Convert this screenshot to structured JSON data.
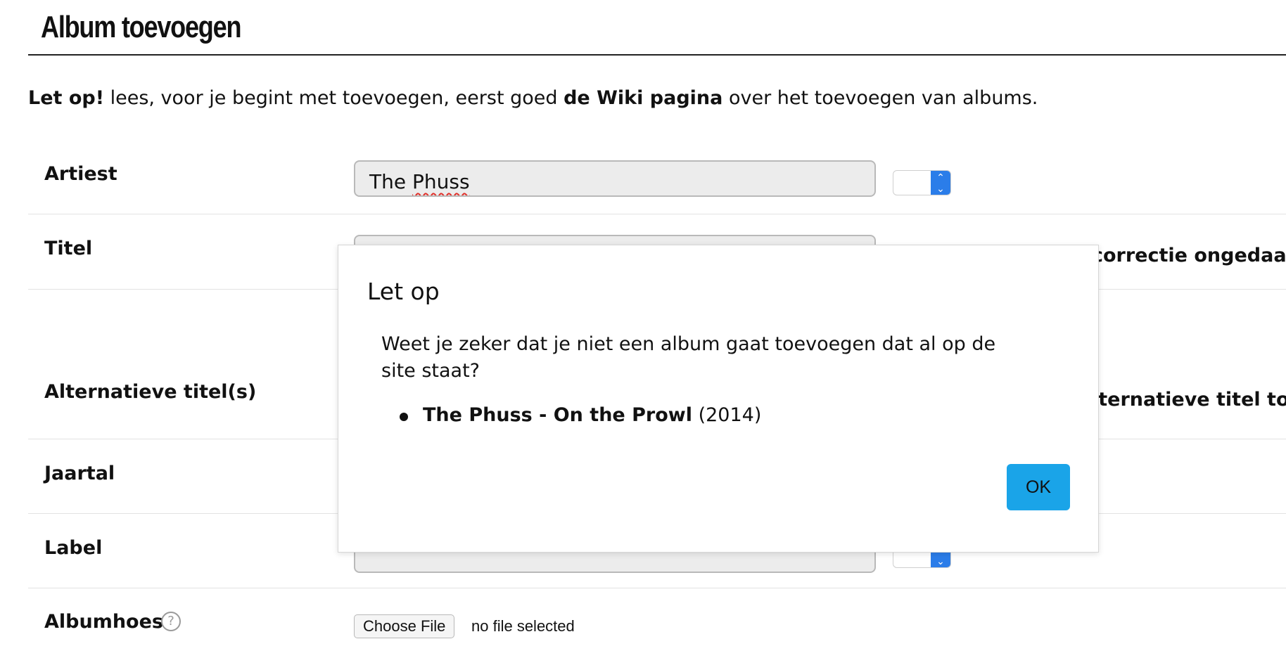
{
  "page": {
    "title": "Album toevoegen",
    "intro": {
      "lead": "Let op!",
      "text_before": " lees, voor je begint met toevoegen, eerst goed ",
      "link": "de Wiki pagina",
      "text_after": " over het toevoegen van albums."
    }
  },
  "form": {
    "artist": {
      "label": "Artiest",
      "value_prefix": "The ",
      "value_flagged": "Phuss"
    },
    "title": {
      "label": "Titel",
      "note": "correctie ongedaan"
    },
    "alt_titles": {
      "label": "Alternatieve titel(s)",
      "note": "lternatieve titel toev"
    },
    "year": {
      "label": "Jaartal"
    },
    "record_label": {
      "label": "Label"
    },
    "cover": {
      "label": "Albumhoes",
      "help": "?",
      "button": "Choose File",
      "status": "no file selected"
    }
  },
  "modal": {
    "title": "Let op",
    "message": "Weet je zeker dat je niet een album gaat toevoegen dat al op de site staat?",
    "matches": [
      {
        "name": "The Phuss - On the Prowl",
        "year": "(2014)"
      }
    ],
    "ok_label": "OK"
  },
  "colors": {
    "accent": "#1aa4e8",
    "select_arrow": "#2b7de9",
    "field_bg": "#ececec"
  }
}
